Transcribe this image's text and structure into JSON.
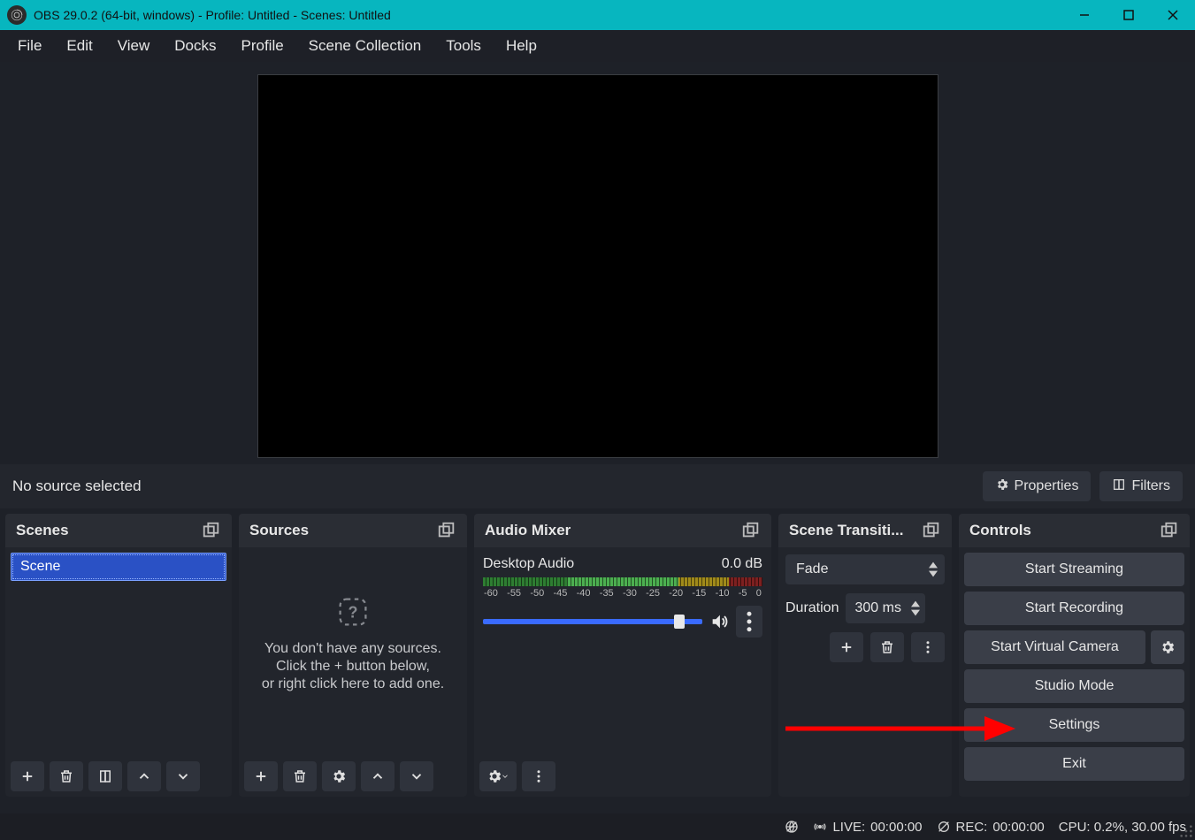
{
  "window": {
    "title": "OBS 29.0.2 (64-bit, windows) - Profile: Untitled - Scenes: Untitled"
  },
  "menu": {
    "file": "File",
    "edit": "Edit",
    "view": "View",
    "docks": "Docks",
    "profile": "Profile",
    "scene_collection": "Scene Collection",
    "tools": "Tools",
    "help": "Help"
  },
  "source_bar": {
    "no_source": "No source selected",
    "properties": "Properties",
    "filters": "Filters"
  },
  "docks_titles": {
    "scenes": "Scenes",
    "sources": "Sources",
    "audio_mixer": "Audio Mixer",
    "scene_transitions": "Scene Transiti...",
    "controls": "Controls"
  },
  "scenes": {
    "items": [
      "Scene"
    ]
  },
  "sources": {
    "empty_line1": "You don't have any sources.",
    "empty_line2": "Click the + button below,",
    "empty_line3": "or right click here to add one."
  },
  "audio": {
    "track_name": "Desktop Audio",
    "level": "0.0 dB",
    "ticks": [
      "-60",
      "-55",
      "-50",
      "-45",
      "-40",
      "-35",
      "-30",
      "-25",
      "-20",
      "-15",
      "-10",
      "-5",
      "0"
    ]
  },
  "transitions": {
    "selected": "Fade",
    "duration_label": "Duration",
    "duration_value": "300 ms"
  },
  "controls": {
    "start_streaming": "Start Streaming",
    "start_recording": "Start Recording",
    "start_virtual_camera": "Start Virtual Camera",
    "studio_mode": "Studio Mode",
    "settings": "Settings",
    "exit": "Exit"
  },
  "status": {
    "live_label": "LIVE:",
    "live_time": "00:00:00",
    "rec_label": "REC:",
    "rec_time": "00:00:00",
    "cpu": "CPU: 0.2%, 30.00 fps"
  }
}
